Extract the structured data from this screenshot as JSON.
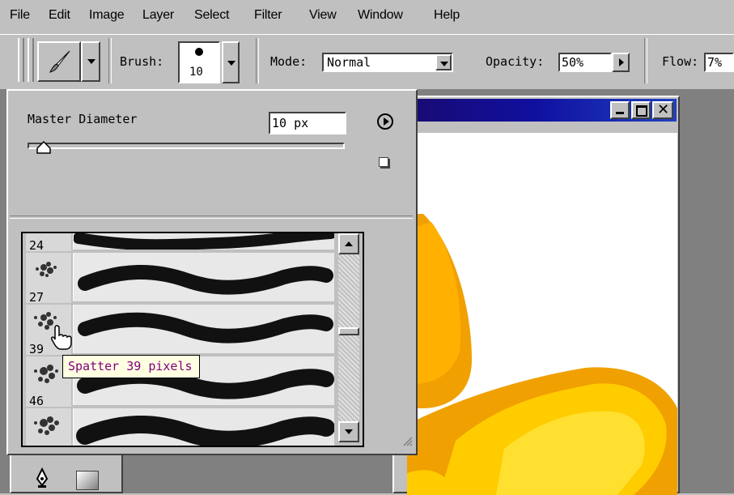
{
  "menu": {
    "items": [
      "File",
      "Edit",
      "Image",
      "Layer",
      "Select",
      "Filter",
      "View",
      "Window",
      "Help"
    ]
  },
  "options": {
    "brush_label": "Brush:",
    "brush_size": "10",
    "mode_label": "Mode:",
    "mode_value": "Normal",
    "opacity_label": "Opacity:",
    "opacity_value": "50%",
    "flow_label": "Flow:",
    "flow_value": "7%"
  },
  "popup": {
    "master_diameter_label": "Master Diameter",
    "master_diameter_value": "10 px",
    "slider_fraction": 0.05,
    "brushes": [
      {
        "size": "24"
      },
      {
        "size": "27"
      },
      {
        "size": "39"
      },
      {
        "size": "46"
      },
      {
        "size": ""
      }
    ],
    "tooltip": "Spatter 39 pixels"
  },
  "colors": {
    "chrome": "#c0c0c0",
    "titlebar": "#1010a0",
    "duck_yellow": "#ffcc00",
    "duck_orange": "#f0a000",
    "tooltip_bg": "#ffffe1",
    "tooltip_text": "#800080"
  },
  "icons": {
    "tool": "brush-icon",
    "menu_arrow": "play-circle-icon",
    "new_preset": "new-preset-icon",
    "window_controls": [
      "minimize-icon",
      "maximize-icon",
      "close-icon"
    ],
    "toolbox": [
      "pen-icon",
      "gradient-icon"
    ],
    "cursor": "hand-pointer-icon"
  }
}
